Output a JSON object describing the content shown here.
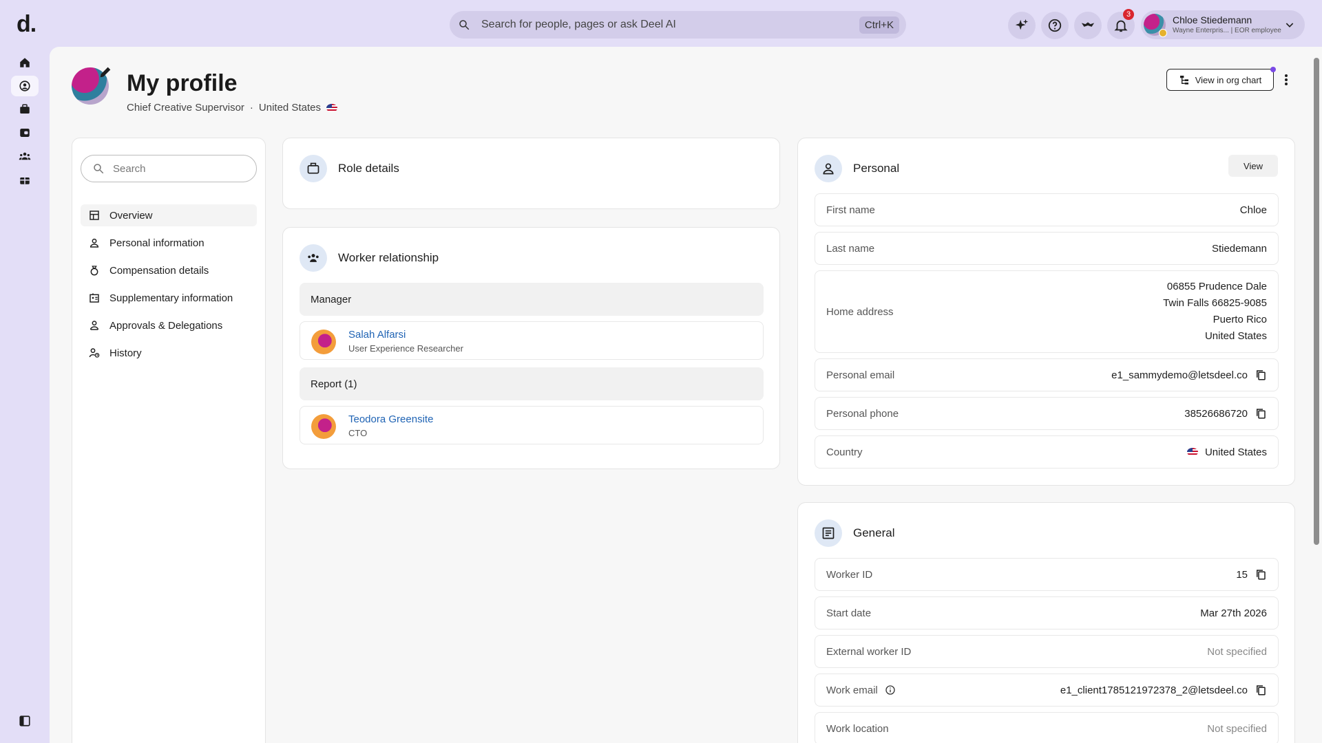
{
  "brand": {
    "logo_text": "d."
  },
  "search": {
    "placeholder": "Search for people, pages or ask Deel AI",
    "shortcut": "Ctrl+K"
  },
  "topbar": {
    "notifications_count": "3"
  },
  "user": {
    "name": "Chloe Stiedemann",
    "subtitle": "Wayne Enterpris... | EOR employee"
  },
  "header": {
    "title": "My profile",
    "job_title": "Chief Creative Supervisor",
    "separator": "·",
    "country": "United States",
    "org_chart_button": "View in org chart"
  },
  "sidebar": {
    "search_placeholder": "Search",
    "items": [
      {
        "label": "Overview",
        "icon": "layout-icon"
      },
      {
        "label": "Personal information",
        "icon": "person-icon"
      },
      {
        "label": "Compensation details",
        "icon": "money-bag-icon"
      },
      {
        "label": "Supplementary information",
        "icon": "id-card-icon"
      },
      {
        "label": "Approvals & Delegations",
        "icon": "approval-icon"
      },
      {
        "label": "History",
        "icon": "history-person-icon"
      }
    ]
  },
  "role_details": {
    "title": "Role details"
  },
  "worker_relationship": {
    "title": "Worker relationship",
    "manager_label": "Manager",
    "manager": {
      "name": "Salah Alfarsi",
      "role": "User Experience Researcher"
    },
    "reports_label": "Report (1)",
    "report": {
      "name": "Teodora Greensite",
      "role": "CTO"
    }
  },
  "personal": {
    "title": "Personal",
    "view_button": "View",
    "first_name_label": "First name",
    "first_name": "Chloe",
    "last_name_label": "Last name",
    "last_name": "Stiedemann",
    "address_label": "Home address",
    "address_line1": "06855 Prudence Dale",
    "address_line2": "Twin Falls 66825-9085",
    "address_line3": "Puerto Rico",
    "address_line4": "United States",
    "email_label": "Personal email",
    "email": "e1_sammydemo@letsdeel.co",
    "phone_label": "Personal phone",
    "phone": "38526686720",
    "country_label": "Country",
    "country": "United States"
  },
  "general": {
    "title": "General",
    "worker_id_label": "Worker ID",
    "worker_id": "15",
    "start_date_label": "Start date",
    "start_date": "Mar 27th 2026",
    "external_id_label": "External worker ID",
    "external_id": "Not specified",
    "work_email_label": "Work email",
    "work_email": "e1_client1785121972378_2@letsdeel.co",
    "work_location_label": "Work location",
    "work_location": "Not specified"
  },
  "colors": {
    "topbar_bg": "#e3def7",
    "link": "#1f63b4",
    "badge": "#d9262e",
    "accent": "#7a4ae6"
  }
}
